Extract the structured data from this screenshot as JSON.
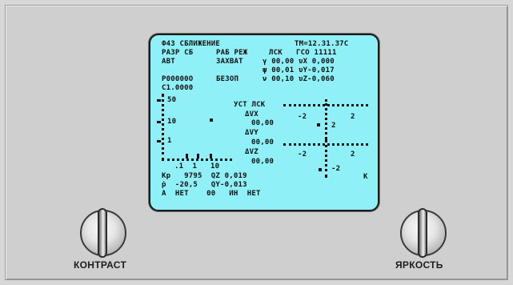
{
  "display": {
    "line1_left": "Ф43 СБЛИЖЕНИЕ",
    "line1_right": "ТМ=12.31.37С",
    "line2_a": "РАЗР СБ",
    "line2_b": "РАБ РЕЖ",
    "line2_c": "ЛСК",
    "line2_d": "ГСО 11111",
    "line3_a": "АВТ",
    "line3_b": "ЗАХВАТ",
    "line3_c": "γ 00,00 υX 0,000",
    "line4": "ψ 00,01 υY-0,017",
    "line5_a": "Р00000О",
    "line5_b": "БЕЗОП",
    "line5_c": "ν 00,10 υZ-0,060",
    "line6": "С1.0000",
    "scale_50": "50",
    "scale_10": "10",
    "scale_1": "1",
    "scale_x_labels": ".1  1   10",
    "ust_lsk": "УСТ ЛСК",
    "dvx_label": "ΔVX",
    "dvx_value": "00,00",
    "dvy_label": "ΔVY",
    "dvy_value": "00,00",
    "dvz_label": "ΔVZ",
    "dvz_value": "00,00",
    "cross1_left": "-2",
    "cross1_right": "2",
    "cross1_bottom": "2",
    "cross2_left": "-2",
    "cross2_right": "2",
    "cross2_bottom": "-2",
    "k_label": "К",
    "kr_line": "Кр   9795  QZ 0,019",
    "pdot_line": "ṗ  -20,5   QY-0,013",
    "last_line": "А  НЕТ    00   ИН  НЕТ"
  },
  "controls": {
    "contrast_label": "КОНТРАСТ",
    "brightness_label": "ЯРКОСТЬ"
  },
  "colors": {
    "screen": "#8ff0f7",
    "panel": "#cfcfcf",
    "text": "#101010"
  }
}
